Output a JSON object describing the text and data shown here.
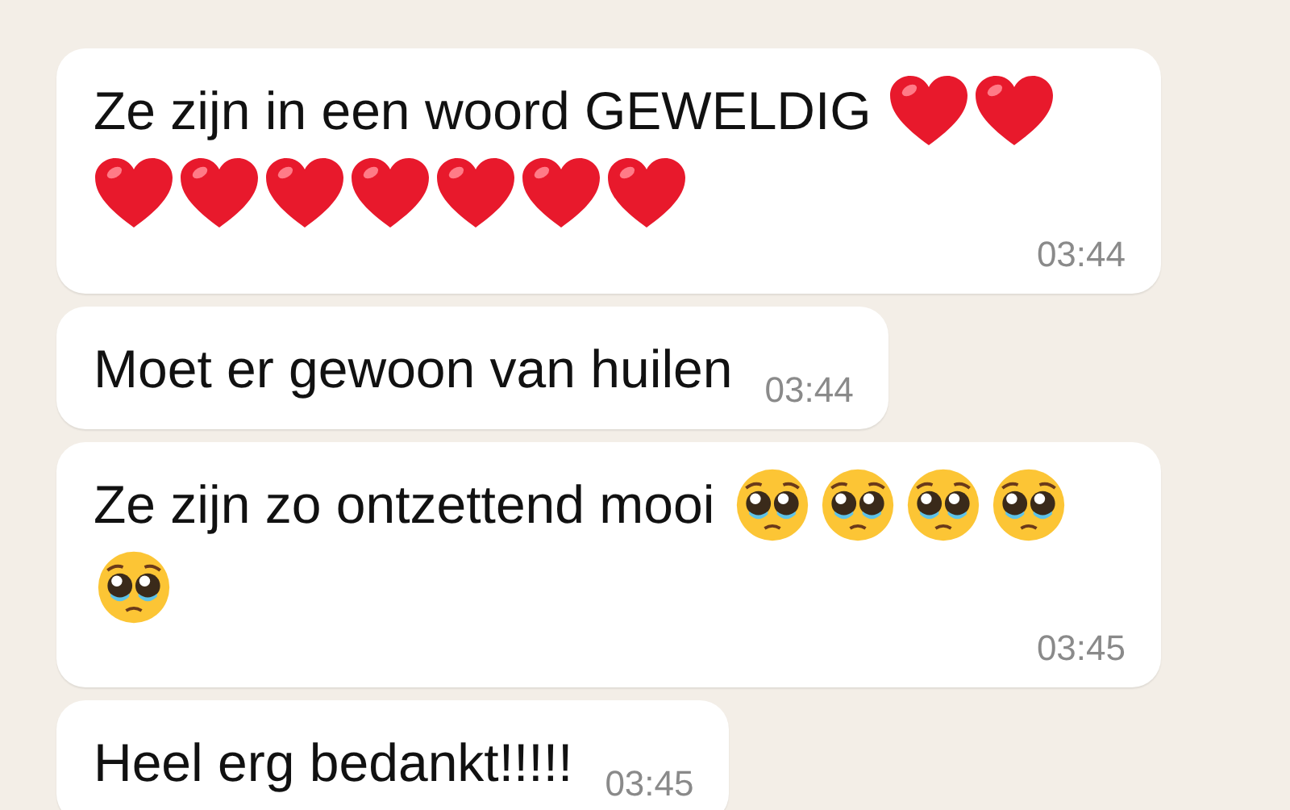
{
  "messages": [
    {
      "text": "Ze zijn in een woord GEWELDIG",
      "emoji": [
        {
          "kind": "heart"
        },
        {
          "kind": "heart"
        },
        {
          "kind": "heart"
        },
        {
          "kind": "heart"
        },
        {
          "kind": "heart"
        },
        {
          "kind": "heart"
        },
        {
          "kind": "heart"
        },
        {
          "kind": "heart"
        },
        {
          "kind": "heart"
        }
      ],
      "time": "03:44"
    },
    {
      "text": "Moet er gewoon van huilen",
      "time": "03:44"
    },
    {
      "text": "Ze zijn zo ontzettend mooi",
      "emoji": [
        {
          "kind": "pleading"
        },
        {
          "kind": "pleading"
        },
        {
          "kind": "pleading"
        },
        {
          "kind": "pleading"
        },
        {
          "kind": "pleading"
        }
      ],
      "time": "03:45"
    },
    {
      "text": "Heel erg bedankt!!!!!",
      "time": "03:45"
    }
  ]
}
